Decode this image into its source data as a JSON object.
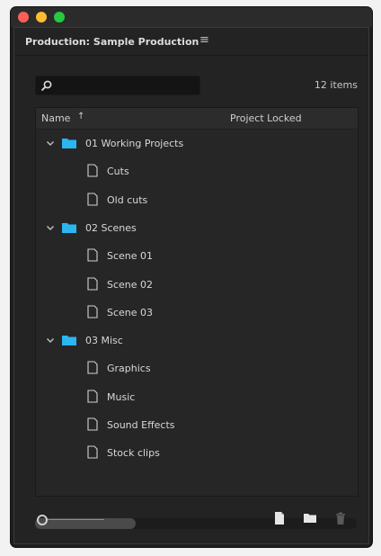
{
  "window": {
    "traffic_lights": {
      "close": "#ff5f57",
      "minimize": "#febc2e",
      "zoom": "#28c840"
    }
  },
  "panel": {
    "title": "Production: Sample Production",
    "menu_glyph": "≡"
  },
  "search": {
    "value": "",
    "placeholder": ""
  },
  "item_count": "12 items",
  "columns": {
    "name": "Name",
    "sort_indicator": "↑",
    "project_locked": "Project Locked"
  },
  "tree": {
    "folder_color": "#2bb6f0",
    "rows": [
      {
        "type": "folder",
        "label": "01 Working Projects",
        "expanded": true
      },
      {
        "type": "file",
        "label": "Cuts"
      },
      {
        "type": "file",
        "label": "Old cuts"
      },
      {
        "type": "folder",
        "label": "02 Scenes",
        "expanded": true
      },
      {
        "type": "file",
        "label": "Scene 01"
      },
      {
        "type": "file",
        "label": "Scene 02"
      },
      {
        "type": "file",
        "label": "Scene 03"
      },
      {
        "type": "folder",
        "label": "03 Misc",
        "expanded": true
      },
      {
        "type": "file",
        "label": "Graphics"
      },
      {
        "type": "file",
        "label": "Music"
      },
      {
        "type": "file",
        "label": "Sound Effects"
      },
      {
        "type": "file",
        "label": "Stock clips"
      }
    ]
  },
  "footer": {
    "zoom_level": 0,
    "icons": [
      "new-item-icon",
      "new-folder-icon",
      "trash-icon"
    ]
  }
}
